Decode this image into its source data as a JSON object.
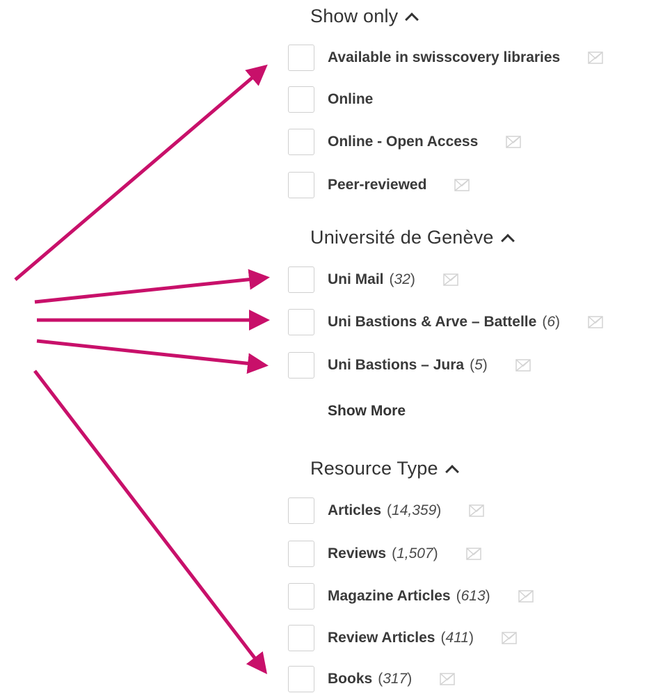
{
  "sections": [
    {
      "title": "Show only",
      "items": [
        {
          "label": "Available in swisscovery libraries",
          "count": ""
        },
        {
          "label": "Online",
          "count": ""
        },
        {
          "label": "Online - Open Access",
          "count": ""
        },
        {
          "label": "Peer-reviewed",
          "count": ""
        }
      ]
    },
    {
      "title": "Université de Genève",
      "items": [
        {
          "label": "Uni Mail",
          "count": "32"
        },
        {
          "label": "Uni Bastions & Arve – Battelle",
          "count": "6"
        },
        {
          "label": "Uni Bastions – Jura",
          "count": "5"
        }
      ],
      "show_more": "Show More"
    },
    {
      "title": "Resource Type",
      "items": [
        {
          "label": "Articles",
          "count": "14,359"
        },
        {
          "label": "Reviews",
          "count": "1,507"
        },
        {
          "label": "Magazine Articles",
          "count": "613"
        },
        {
          "label": "Review Articles",
          "count": "411"
        },
        {
          "label": "Books",
          "count": "317"
        }
      ]
    }
  ],
  "colors": {
    "arrow": "#c8106a",
    "exclude_icon": "#d3d3d3",
    "checkbox_border": "#cfcfcf"
  },
  "icons": {
    "collapse": "chevron-up-icon",
    "exclude": "exclude-envelope-icon"
  }
}
